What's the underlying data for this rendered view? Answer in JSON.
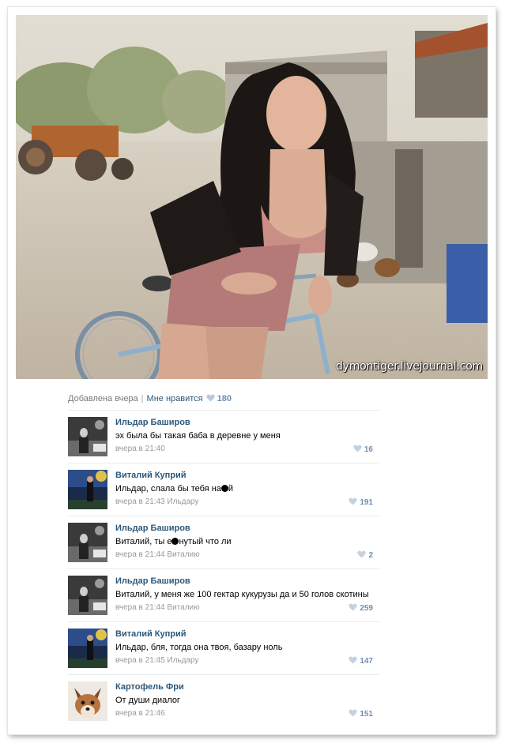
{
  "photo": {
    "watermark": "dymontiger.livejournal.com"
  },
  "post_meta": {
    "added": "Добавлена вчера",
    "separator": "|",
    "like_label": "Мне нравится",
    "like_count": "180"
  },
  "colors": {
    "link": "#2b587a",
    "like_blue": "#6d8fb3",
    "muted": "#999999"
  },
  "comments": [
    {
      "author": "Ильдар Баширов",
      "text": "эх была бы такая баба в деревне у меня",
      "time": "вчера в 21:40",
      "reply_to": "",
      "likes": "16",
      "avatar": "avatar-bw-photo-icon"
    },
    {
      "author": "Виталий Куприй",
      "text_before": "Ильдар, слала бы тебя на",
      "text_after": "й",
      "time": "вчера в 21:43 Ильдару",
      "likes": "191",
      "avatar": "avatar-blue-photo-icon"
    },
    {
      "author": "Ильдар Баширов",
      "text_before": "Виталий, ты е",
      "text_after": "нутый что ли",
      "time": "вчера в 21:44 Виталию",
      "likes": "2",
      "avatar": "avatar-bw-photo-icon"
    },
    {
      "author": "Ильдар Баширов",
      "text": "Виталий, у меня же 100 гектар кукурузы да и 50 голов скотины",
      "time": "вчера в 21:44 Виталию",
      "likes": "259",
      "avatar": "avatar-bw-photo-icon"
    },
    {
      "author": "Виталий Куприй",
      "text": "Ильдар, бля, тогда она твоя, базару ноль",
      "time": "вчера в 21:45 Ильдару",
      "likes": "147",
      "avatar": "avatar-blue-photo-icon"
    },
    {
      "author": "Картофель Фри",
      "text": "От души диалог",
      "time": "вчера в 21:46",
      "likes": "151",
      "avatar": "avatar-fox-icon"
    }
  ]
}
